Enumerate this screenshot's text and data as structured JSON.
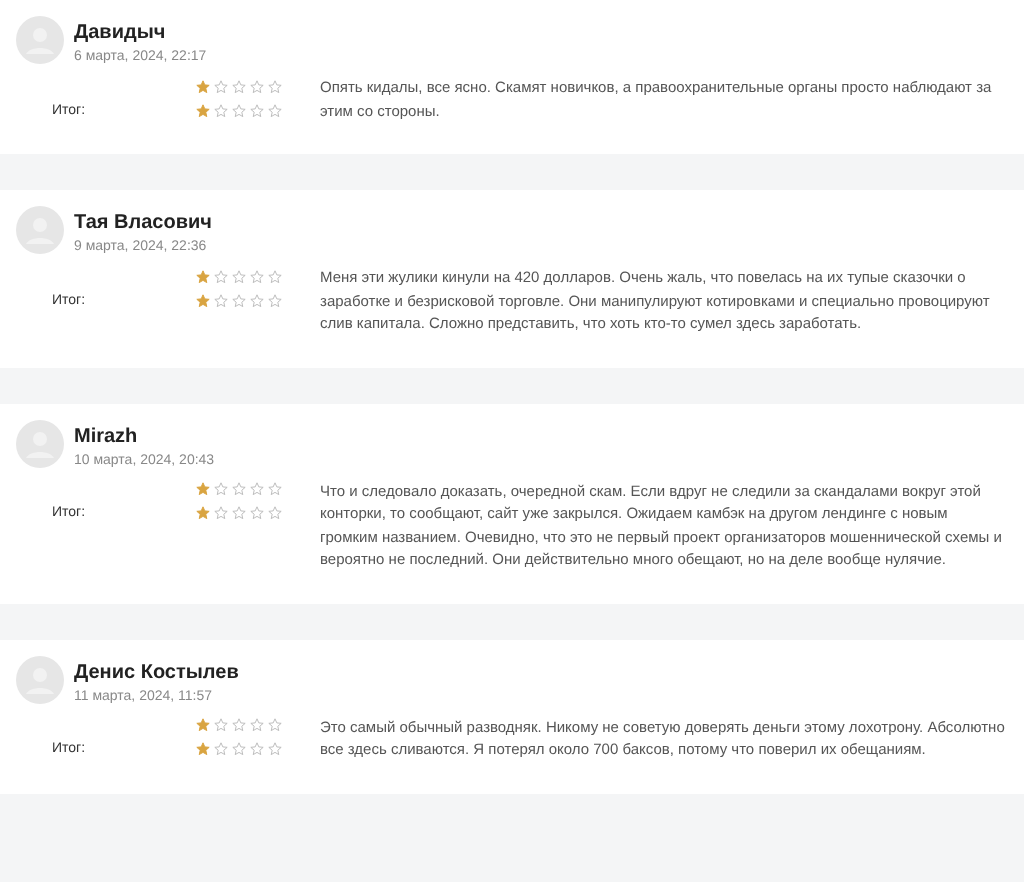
{
  "reviews": [
    {
      "name": "Давидыч",
      "date": "6 марта, 2024, 22:17",
      "ratings": [
        {
          "stars": 1
        },
        {
          "label": "Итог:",
          "stars": 1
        }
      ],
      "text": "Опять кидалы, все ясно. Скамят новичков, а правоохранительные органы просто наблюдают за этим со стороны."
    },
    {
      "name": "Тая Власович",
      "date": "9 марта, 2024, 22:36",
      "ratings": [
        {
          "stars": 1
        },
        {
          "label": "Итог:",
          "stars": 1
        }
      ],
      "text": "Меня эти жулики кинули на 420 долларов. Очень жаль, что повелась на их тупые сказочки о заработке и безрисковой торговле. Они манипулируют котировками и специально провоцируют слив капитала. Сложно представить, что хоть кто-то сумел здесь заработать."
    },
    {
      "name": "Mirazh",
      "date": "10 марта, 2024, 20:43",
      "ratings": [
        {
          "stars": 1
        },
        {
          "label": "Итог:",
          "stars": 1
        }
      ],
      "text": "Что и следовало доказать, очередной скам. Если вдруг не следили за скандалами вокруг этой конторки, то сообщают, сайт уже закрылся. Ожидаем камбэк на другом лендинге с новым громким названием. Очевидно, что это не первый проект организаторов мошеннической схемы и вероятно не последний. Они действительно много обещают, но на деле вообще нулячие."
    },
    {
      "name": "Денис Костылев",
      "date": "11 марта, 2024, 11:57",
      "ratings": [
        {
          "stars": 1
        },
        {
          "label": "Итог:",
          "stars": 1
        }
      ],
      "text": "Это самый обычный разводняк. Никому не советую доверять деньги этому лохотрону. Абсолютно все здесь сливаются. Я потерял около 700 баксов, потому что поверил их обещаниям."
    }
  ]
}
